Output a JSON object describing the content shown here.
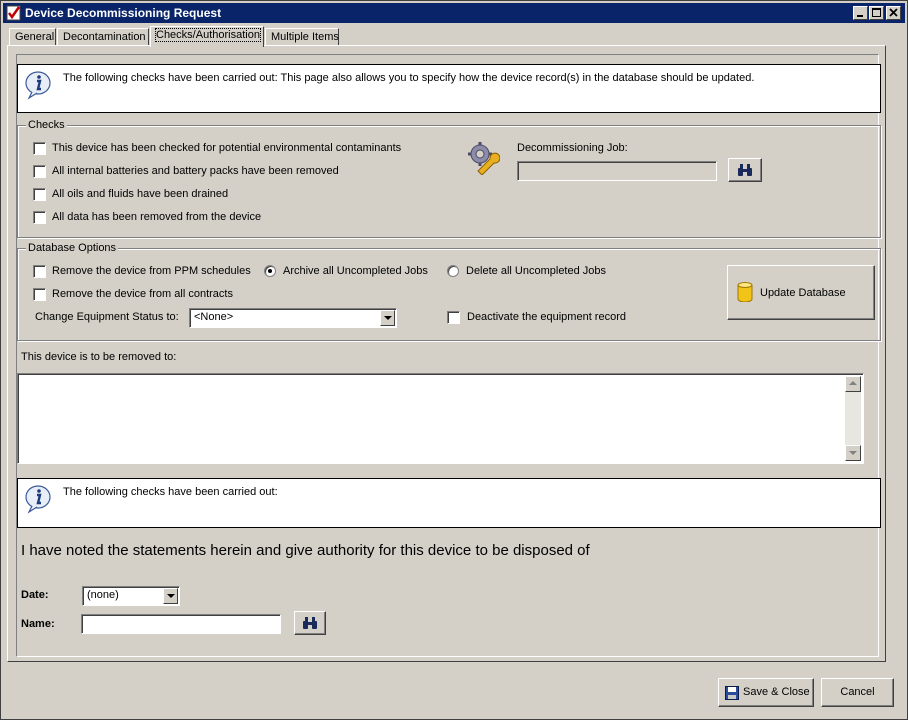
{
  "window": {
    "title": "Device Decommissioning Request"
  },
  "tabs": [
    {
      "label": "General"
    },
    {
      "label": "Decontamination"
    },
    {
      "label": "Checks/Authorisation"
    },
    {
      "label": "Multiple Items"
    }
  ],
  "info_top": {
    "text": "The following checks have been carried out: This page also allows you to specify how the device record(s) in the database should be updated."
  },
  "checks": {
    "title": "Checks",
    "items": [
      {
        "label": "This device has been checked for potential environmental contaminants",
        "checked": false
      },
      {
        "label": "All internal batteries and battery packs have been removed",
        "checked": false
      },
      {
        "label": "All oils and fluids have been drained",
        "checked": false
      },
      {
        "label": "All data has been removed from the device",
        "checked": false
      }
    ],
    "job_label": "Decommissioning Job:",
    "job_value": ""
  },
  "database_options": {
    "title": "Database Options",
    "remove_ppm": "Remove the device from PPM schedules",
    "remove_contracts": "Remove the device from all contracts",
    "archive_jobs": "Archive all Uncompleted Jobs",
    "delete_jobs": "Delete all Uncompleted Jobs",
    "selected_job_option": "archive",
    "status_label": "Change Equipment Status to:",
    "status_value": "<None>",
    "deactivate": "Deactivate the equipment record",
    "update_button": "Update Database"
  },
  "removal": {
    "label": "This device is to be removed to:",
    "value": ""
  },
  "info_bottom": {
    "text": "The following checks have been carried out:"
  },
  "statement": "I have noted the statements herein and give authority for this device to be disposed of",
  "auth": {
    "date_label": "Date:",
    "date_value": "(none)",
    "name_label": "Name:",
    "name_value": ""
  },
  "footer": {
    "save_close": "Save & Close",
    "cancel": "Cancel"
  },
  "colors": {
    "titlebar": "#0a246a",
    "face": "#d4d0c8"
  },
  "icons": [
    "app-icon",
    "info-icon",
    "wrench-gear-icon",
    "binoculars-icon",
    "database-icon",
    "floppy-disk-icon"
  ]
}
